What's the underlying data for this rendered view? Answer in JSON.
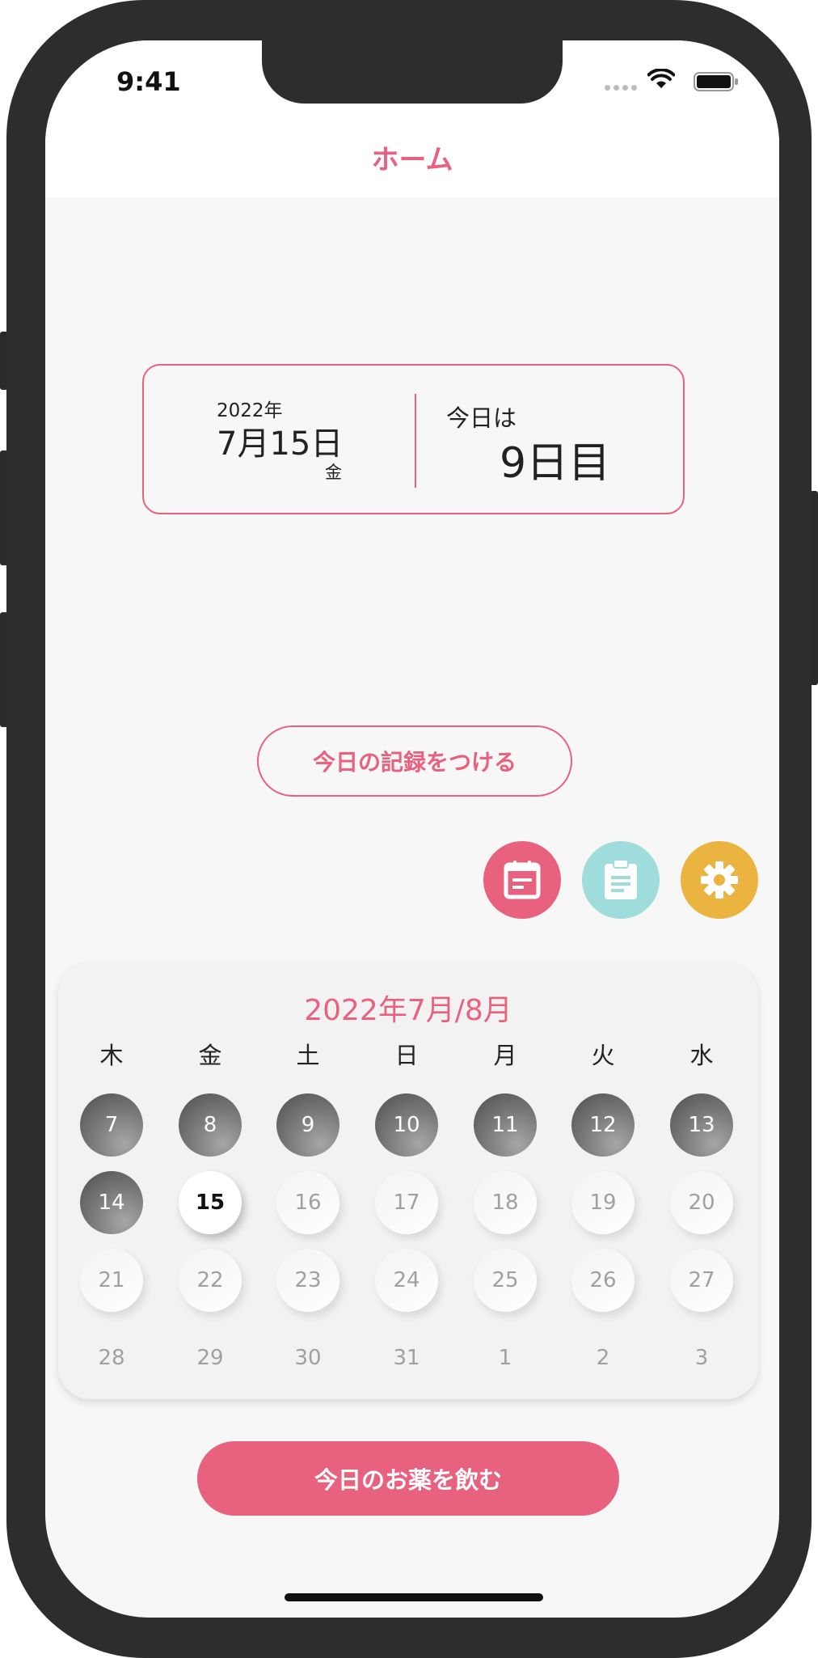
{
  "status_bar": {
    "time": "9:41"
  },
  "nav": {
    "title": "ホーム"
  },
  "date_card": {
    "year": "2022年",
    "month_day": "7月15日",
    "weekday": "金",
    "today_label": "今日は",
    "day_count": "9日目"
  },
  "record_button": "今日の記録をつける",
  "actions": [
    "calendar-icon",
    "clipboard-icon",
    "gear-icon"
  ],
  "calendar": {
    "title": "2022年7月/8月",
    "weekdays": [
      "木",
      "金",
      "土",
      "日",
      "月",
      "火",
      "水"
    ],
    "rows": [
      [
        {
          "d": "7",
          "s": "past"
        },
        {
          "d": "8",
          "s": "past"
        },
        {
          "d": "9",
          "s": "past"
        },
        {
          "d": "10",
          "s": "past"
        },
        {
          "d": "11",
          "s": "past"
        },
        {
          "d": "12",
          "s": "past"
        },
        {
          "d": "13",
          "s": "past"
        }
      ],
      [
        {
          "d": "14",
          "s": "past"
        },
        {
          "d": "15",
          "s": "today"
        },
        {
          "d": "16",
          "s": "future"
        },
        {
          "d": "17",
          "s": "future"
        },
        {
          "d": "18",
          "s": "future"
        },
        {
          "d": "19",
          "s": "future"
        },
        {
          "d": "20",
          "s": "future"
        }
      ],
      [
        {
          "d": "21",
          "s": "future"
        },
        {
          "d": "22",
          "s": "future"
        },
        {
          "d": "23",
          "s": "future"
        },
        {
          "d": "24",
          "s": "future"
        },
        {
          "d": "25",
          "s": "future"
        },
        {
          "d": "26",
          "s": "future"
        },
        {
          "d": "27",
          "s": "future"
        }
      ],
      [
        {
          "d": "28",
          "s": "later"
        },
        {
          "d": "29",
          "s": "later"
        },
        {
          "d": "30",
          "s": "later"
        },
        {
          "d": "31",
          "s": "later"
        },
        {
          "d": "1",
          "s": "later"
        },
        {
          "d": "2",
          "s": "later"
        },
        {
          "d": "3",
          "s": "later"
        }
      ]
    ]
  },
  "drink_button": "今日のお薬を飲む",
  "colors": {
    "accent": "#e8617f",
    "teal": "#9fdcdc",
    "amber": "#ebb440"
  }
}
